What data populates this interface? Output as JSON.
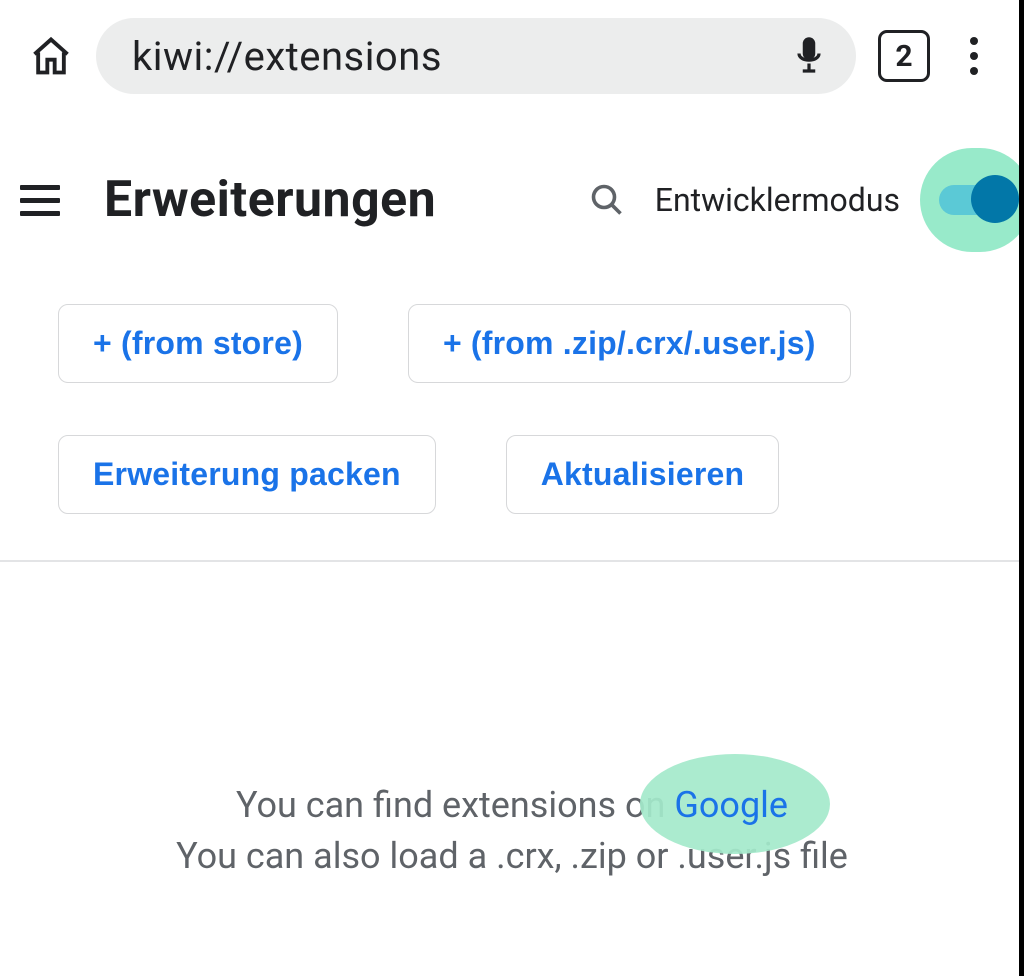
{
  "browser": {
    "url": "kiwi://extensions",
    "tab_count": "2"
  },
  "header": {
    "title": "Erweiterungen",
    "dev_mode_label": "Entwicklermodus",
    "dev_mode_on": true
  },
  "buttons": {
    "from_store": "+ (from store)",
    "from_file": "+ (from .zip/.crx/.user.js)",
    "pack": "Erweiterung packen",
    "update": "Aktualisieren"
  },
  "info": {
    "line1_prefix": "You can find extensions on ",
    "line1_link": "Google",
    "line2": "You can also load a .crx, .zip or .user.js file"
  }
}
